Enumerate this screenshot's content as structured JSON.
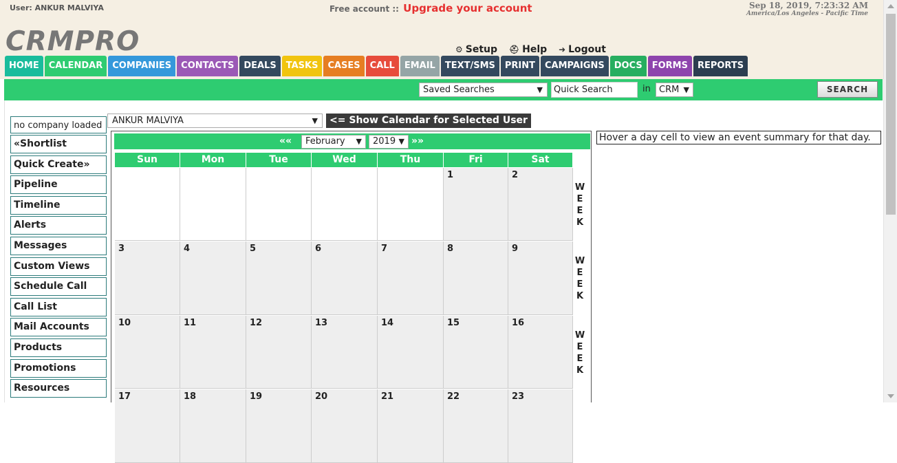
{
  "header": {
    "user_label": "User: ANKUR MALVIYA",
    "account_text": "Free account ::",
    "upgrade_link": "Upgrade your account",
    "datetime": "Sep 18, 2019, 7:23:32 AM",
    "timezone": "America/Los Angeles - Pacific Time",
    "logo": "CRMPRO",
    "links": {
      "setup": "Setup",
      "help": "Help",
      "logout": "Logout"
    }
  },
  "nav": {
    "items": [
      {
        "label": "HOME",
        "color": "#1abc9c"
      },
      {
        "label": "CALENDAR",
        "color": "#2ecc71"
      },
      {
        "label": "COMPANIES",
        "color": "#3498db"
      },
      {
        "label": "CONTACTS",
        "color": "#9b59b6"
      },
      {
        "label": "DEALS",
        "color": "#34495e"
      },
      {
        "label": "TASKS",
        "color": "#f1c40f"
      },
      {
        "label": "CASES",
        "color": "#e67e22"
      },
      {
        "label": "CALL",
        "color": "#e74c3c"
      },
      {
        "label": "EMAIL",
        "color": "#95a5a6"
      },
      {
        "label": "TEXT/SMS",
        "color": "#34495e"
      },
      {
        "label": "PRINT",
        "color": "#34495e"
      },
      {
        "label": "CAMPAIGNS",
        "color": "#34495e"
      },
      {
        "label": "DOCS",
        "color": "#27ae60"
      },
      {
        "label": "FORMS",
        "color": "#8e44ad"
      },
      {
        "label": "REPORTS",
        "color": "#2c3e50"
      }
    ]
  },
  "search": {
    "saved_searches": "Saved Searches",
    "quick_search_placeholder": "Quick Search",
    "in_label": "in",
    "scope": "CRM",
    "button": "SEARCH"
  },
  "sidebar": {
    "company": "no company loaded",
    "items": [
      "«Shortlist",
      "Quick Create»",
      "Pipeline",
      "Timeline",
      "Alerts",
      "Messages",
      "Custom Views",
      "Schedule Call",
      "Call List",
      "Mail Accounts",
      "Products",
      "Promotions",
      "Resources"
    ]
  },
  "calendar": {
    "user": "ANKUR MALVIYA",
    "show_button": "<= Show Calendar for Selected User",
    "prev": "««",
    "next": "»»",
    "month": "February",
    "year": "2019",
    "days": [
      "Sun",
      "Mon",
      "Tue",
      "Wed",
      "Thu",
      "Fri",
      "Sat"
    ],
    "week_label": "WEEK",
    "weeks": [
      [
        "",
        "",
        "",
        "",
        "",
        "1",
        "2"
      ],
      [
        "3",
        "4",
        "5",
        "6",
        "7",
        "8",
        "9"
      ],
      [
        "10",
        "11",
        "12",
        "13",
        "14",
        "15",
        "16"
      ],
      [
        "17",
        "18",
        "19",
        "20",
        "21",
        "22",
        "23"
      ]
    ]
  },
  "hover_note": "Hover a day cell to view an event summary for that day."
}
